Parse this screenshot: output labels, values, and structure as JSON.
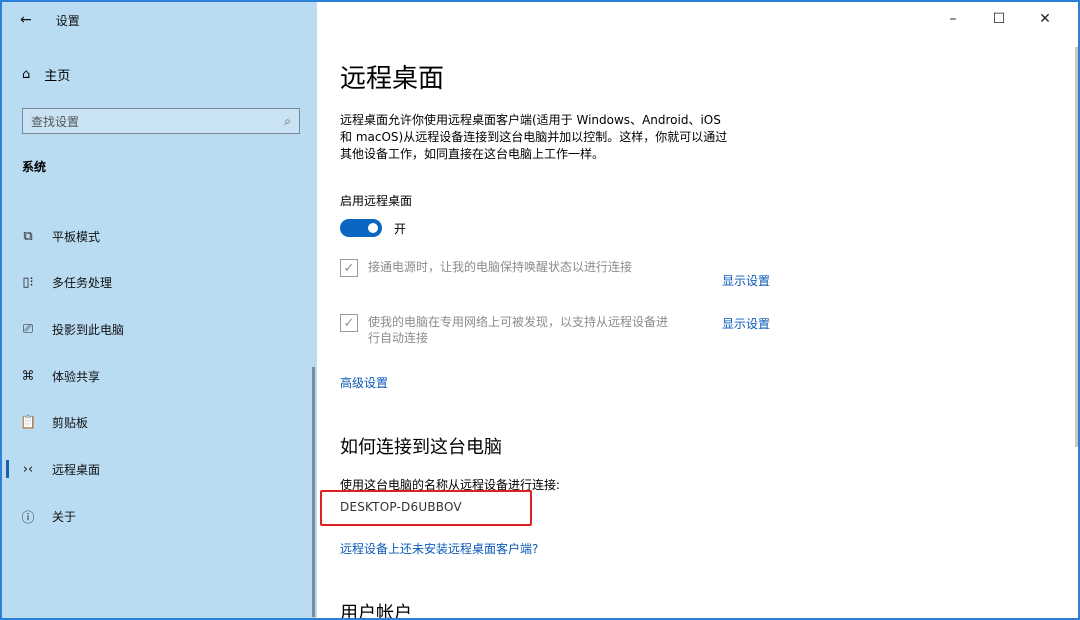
{
  "window": {
    "back_icon": "back-arrow-icon",
    "title": "设置",
    "minimize": "–",
    "maximize": "☐",
    "close": "✕"
  },
  "sidebar": {
    "home_label": "主页",
    "search_placeholder": "查找设置",
    "section": "系统",
    "items": [
      {
        "label": "平板模式",
        "icon": "tablet-icon"
      },
      {
        "label": "多任务处理",
        "icon": "multitask-icon"
      },
      {
        "label": "投影到此电脑",
        "icon": "project-icon"
      },
      {
        "label": "体验共享",
        "icon": "share-icon"
      },
      {
        "label": "剪贴板",
        "icon": "clipboard-icon"
      },
      {
        "label": "远程桌面",
        "icon": "remote-desktop-icon",
        "active": true
      },
      {
        "label": "关于",
        "icon": "info-icon"
      }
    ]
  },
  "main": {
    "title": "远程桌面",
    "description_lines": [
      "远程桌面允许你使用远程桌面客户端(适用于 Windows、Android、iOS",
      "和 macOS)从远程设备连接到这台电脑并加以控制。这样，你就可以通过",
      "其他设备工作，如同直接在这台电脑上工作一样。"
    ],
    "enable_label": "启用远程桌面",
    "toggle_state": "开",
    "checkbox1_text": "接通电源时，让我的电脑保持唤醒状态以进行连接",
    "checkbox1_link": "显示设置",
    "checkbox2_line1": "使我的电脑在专用网络上可被发现，以支持从远程设备进",
    "checkbox2_line2": "行自动连接",
    "checkbox2_link": "显示设置",
    "advanced_link": "高级设置",
    "how_to_connect_title": "如何连接到这台电脑",
    "connect_label": "使用这台电脑的名称从远程设备进行连接:",
    "pc_name": "DESKTOP-D6UBBOV",
    "no_client_link": "远程设备上还未安装远程桌面客户端?",
    "user_accounts_title": "用户帐户"
  },
  "colors": {
    "sidebar_bg": "#b9dcf3",
    "accent": "#0a66c2",
    "link": "#0a5ab8",
    "highlight_box": "#e02020"
  }
}
